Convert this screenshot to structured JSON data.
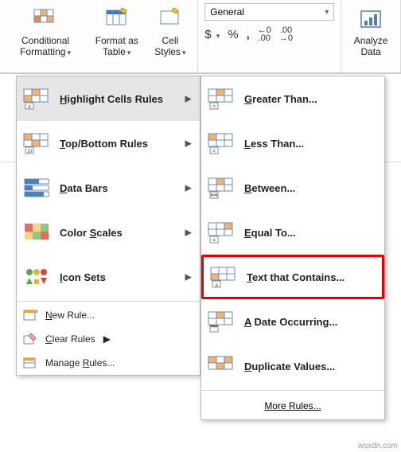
{
  "ribbon": {
    "conditional_formatting": "Conditional Formatting",
    "format_as_table": "Format as Table",
    "cell_styles": "Cell Styles",
    "number_format": "General",
    "analyze_data": "Analyze Data"
  },
  "menu1": {
    "highlight_cells": "Highlight Cells Rules",
    "top_bottom": "Top/Bottom Rules",
    "data_bars": "Data Bars",
    "color_scales": "Color Scales",
    "icon_sets": "Icon Sets",
    "new_rule": "New Rule...",
    "clear_rules": "Clear Rules",
    "manage_rules": "Manage Rules..."
  },
  "menu2": {
    "greater_than": "Greater Than...",
    "less_than": "Less Than...",
    "between": "Between...",
    "equal_to": "Equal To...",
    "text_contains": "Text that Contains...",
    "date_occurring": "A Date Occurring...",
    "duplicate_values": "Duplicate Values...",
    "more_rules": "More Rules..."
  },
  "watermark": "wsxdn.com"
}
